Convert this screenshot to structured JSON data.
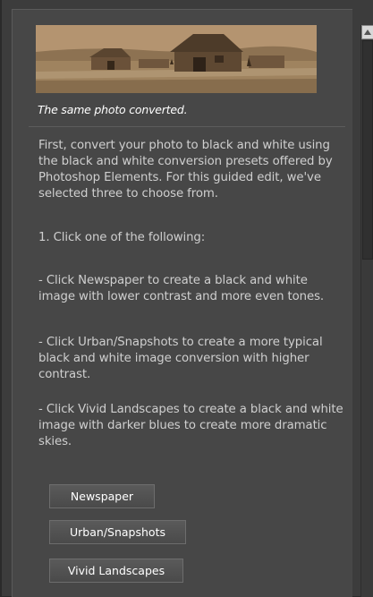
{
  "panel": {
    "caption": "The same photo converted.",
    "paragraphs": [
      "First, convert your photo to black and white using the black and white conversion presets offered by Photoshop Elements. For this guided edit, we've selected three to choose from.",
      "1. Click one of the following:",
      "- Click Newspaper to create a black and white image with lower contrast and more even tones.",
      "- Click Urban/Snapshots to create a more typical black and white image conversion with higher contrast.",
      "- Click Vivid Landscapes to create a black and white image with darker blues to create more dramatic skies."
    ],
    "buttons": [
      "Newspaper",
      "Urban/Snapshots",
      "Vivid Landscapes"
    ]
  },
  "colors": {
    "panel_bg": "#474747",
    "text": "#cfcfcf",
    "caption": "#ffffff",
    "photo_sepia": "#a58661"
  }
}
